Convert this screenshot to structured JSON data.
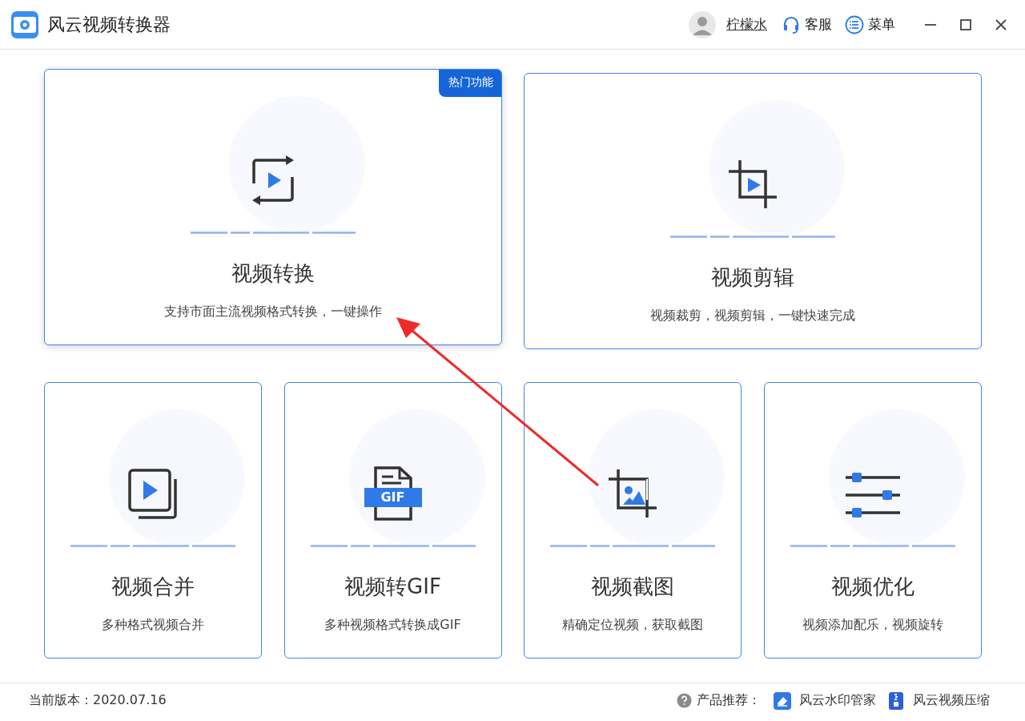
{
  "window": {
    "title": "风云视频转换器"
  },
  "header": {
    "user_name": "柠檬水",
    "service": "客服",
    "menu": "菜单"
  },
  "cards": [
    {
      "kind": "convert",
      "title": "视频转换",
      "description": "支持市面主流视频格式转换，一键操作",
      "wide": true,
      "selected": true,
      "badge": "热门功能"
    },
    {
      "kind": "crop",
      "title": "视频剪辑",
      "description": "视频裁剪，视频剪辑，一键快速完成",
      "wide": true,
      "selected": false
    },
    {
      "kind": "merge",
      "title": "视频合并",
      "description": "多种格式视频合并",
      "wide": false,
      "selected": false
    },
    {
      "kind": "gif",
      "title": "视频转GIF",
      "description": "多种视频格式转换成GIF",
      "wide": false,
      "selected": false,
      "icon_text": "GIF"
    },
    {
      "kind": "screenshot",
      "title": "视频截图",
      "description": "精确定位视频，获取截图",
      "wide": false,
      "selected": false
    },
    {
      "kind": "optimize",
      "title": "视频优化",
      "description": "视频添加配乐，视频旋转",
      "wide": false,
      "selected": false
    }
  ],
  "footer": {
    "version": "当前版本：2020.07.16",
    "recommend_label": "产品推荐：",
    "products": [
      {
        "kind": "watermark",
        "name": "风云水印管家"
      },
      {
        "kind": "compress",
        "name": "风云视频压缩"
      }
    ]
  }
}
